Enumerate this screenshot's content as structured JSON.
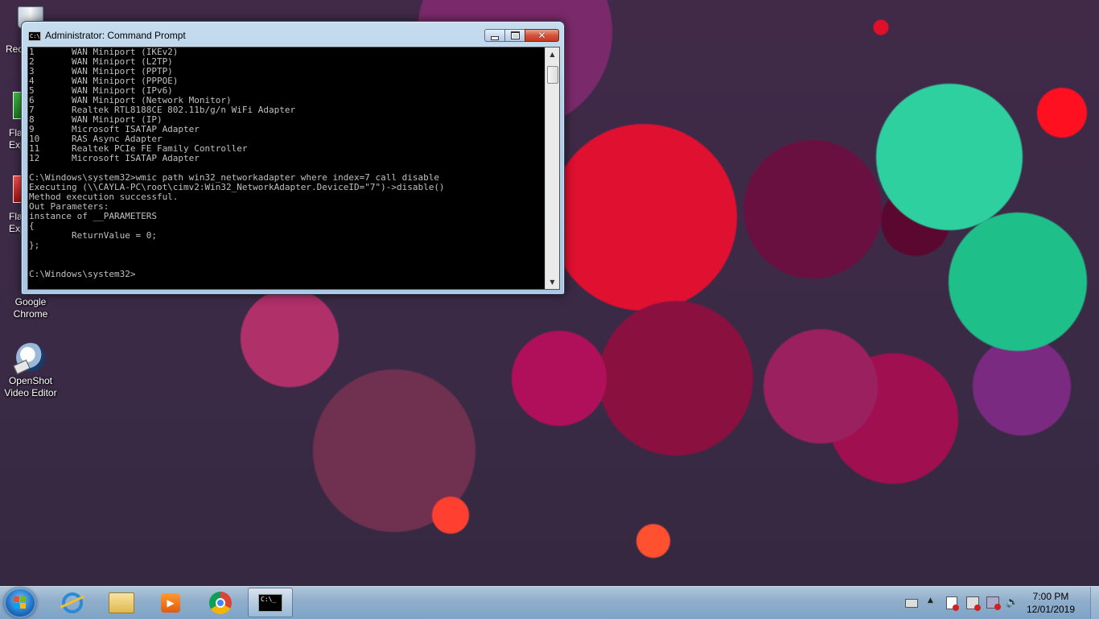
{
  "desktop": {
    "icons": [
      {
        "label_line1": "Google",
        "label_line2": "Chrome"
      },
      {
        "label_line1": "OpenShot",
        "label_line2": "Video Editor"
      }
    ],
    "partial_labels": [
      "Rec",
      "Fla",
      "Exp",
      "Fla",
      "Exp"
    ]
  },
  "window": {
    "title": "Administrator: Command Prompt",
    "icon_text": "C:\\",
    "console_lines": [
      "1       WAN Miniport (IKEv2)",
      "2       WAN Miniport (L2TP)",
      "3       WAN Miniport (PPTP)",
      "4       WAN Miniport (PPPOE)",
      "5       WAN Miniport (IPv6)",
      "6       WAN Miniport (Network Monitor)",
      "7       Realtek RTL8188CE 802.11b/g/n WiFi Adapter",
      "8       WAN Miniport (IP)",
      "9       Microsoft ISATAP Adapter",
      "10      RAS Async Adapter",
      "11      Realtek PCIe FE Family Controller",
      "12      Microsoft ISATAP Adapter",
      "",
      "C:\\Windows\\system32>wmic path win32_networkadapter where index=7 call disable",
      "Executing (\\\\CAYLA-PC\\root\\cimv2:Win32_NetworkAdapter.DeviceID=\"7\")->disable()",
      "Method execution successful.",
      "Out Parameters:",
      "instance of __PARAMETERS",
      "{",
      "        ReturnValue = 0;",
      "};",
      "",
      "",
      "C:\\Windows\\system32>"
    ]
  },
  "taskbar": {
    "cmd_icon_text": "C:\\_",
    "clock_time": "7:00 PM",
    "clock_date": "12/01/2019"
  },
  "colors": {
    "console_bg": "#000000",
    "console_fg": "#c0c0c0",
    "titlebar": "#b5cfe8",
    "close_button": "#c33a20"
  },
  "icons": [
    "recycle-bin-icon",
    "chrome-icon",
    "openshot-icon",
    "ie-icon",
    "explorer-icon",
    "media-player-icon",
    "cmd-icon",
    "keyboard-icon",
    "network-icon",
    "volume-icon"
  ]
}
